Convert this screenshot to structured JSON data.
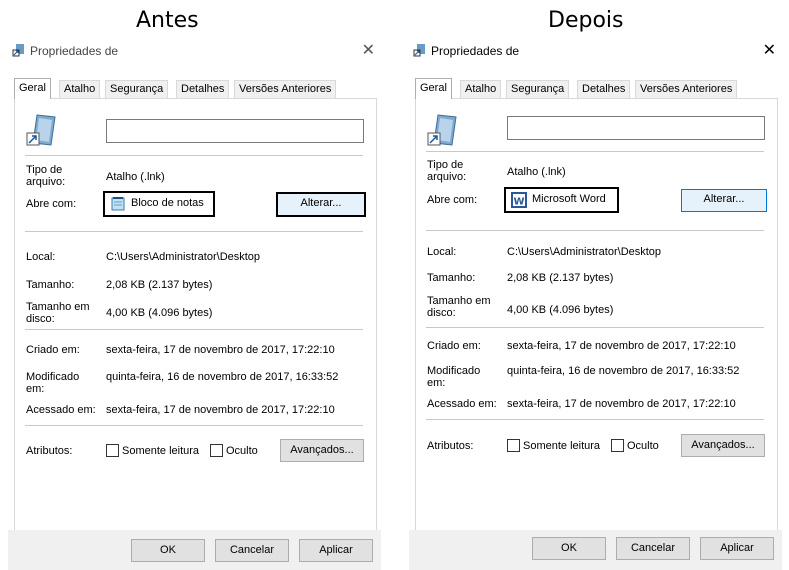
{
  "headings": {
    "before": "Antes",
    "after": "Depois"
  },
  "before": {
    "title": "Propriedades de",
    "tabs": [
      "Geral",
      "Atalho",
      "Segurança",
      "Detalhes",
      "Versões Anteriores"
    ],
    "rows": {
      "type_label": "Tipo de arquivo:",
      "type_value": "Atalho (.lnk)",
      "open_label": "Abre com:",
      "open_value": "Bloco de notas",
      "change_button": "Alterar...",
      "location_label": "Local:",
      "location_value": "C:\\Users\\Administrator\\Desktop",
      "size_label": "Tamanho:",
      "size_value": "2,08 KB (2.137 bytes)",
      "disk_label": "Tamanho em disco:",
      "disk_value": "4,00 KB (4.096 bytes)",
      "created_label": "Criado em:",
      "created_value": "sexta-feira, 17 de novembro de 2017, 17:22:10",
      "modified_label": "Modificado em:",
      "modified_value": "quinta-feira, 16 de novembro de 2017, 16:33:52",
      "accessed_label": "Acessado em:",
      "accessed_value": "sexta-feira, 17 de novembro de 2017, 17:22:10",
      "attr_label": "Atributos:",
      "readonly": "Somente leitura",
      "hidden": "Oculto",
      "advanced": "Avançados..."
    },
    "buttons": {
      "ok": "OK",
      "cancel": "Cancelar",
      "apply": "Aplicar"
    }
  },
  "after": {
    "title": "Propriedades de",
    "tabs": [
      "Geral",
      "Atalho",
      "Segurança",
      "Detalhes",
      "Versões Anteriores"
    ],
    "rows": {
      "type_label": "Tipo de arquivo:",
      "type_value": "Atalho (.lnk)",
      "open_label": "Abre com:",
      "open_value": "Microsoft Word",
      "change_button": "Alterar...",
      "location_label": "Local:",
      "location_value": "C:\\Users\\Administrator\\Desktop",
      "size_label": "Tamanho:",
      "size_value": "2,08 KB (2.137 bytes)",
      "disk_label": "Tamanho em disco:",
      "disk_value": "4,00 KB (4.096 bytes)",
      "created_label": "Criado em:",
      "created_value": "sexta-feira, 17 de novembro de 2017, 17:22:10",
      "modified_label": "Modificado em:",
      "modified_value": "quinta-feira, 16 de novembro de 2017, 16:33:52",
      "accessed_label": "Acessado em:",
      "accessed_value": "sexta-feira, 17 de novembro de 2017, 17:22:10",
      "attr_label": "Atributos:",
      "readonly": "Somente leitura",
      "hidden": "Oculto",
      "advanced": "Avançados..."
    },
    "buttons": {
      "ok": "OK",
      "cancel": "Cancelar",
      "apply": "Aplicar"
    }
  },
  "colors": {
    "accent": "#0078d7",
    "tab_bg": "#f0f0f0",
    "button_bg": "#e1e1e1"
  }
}
